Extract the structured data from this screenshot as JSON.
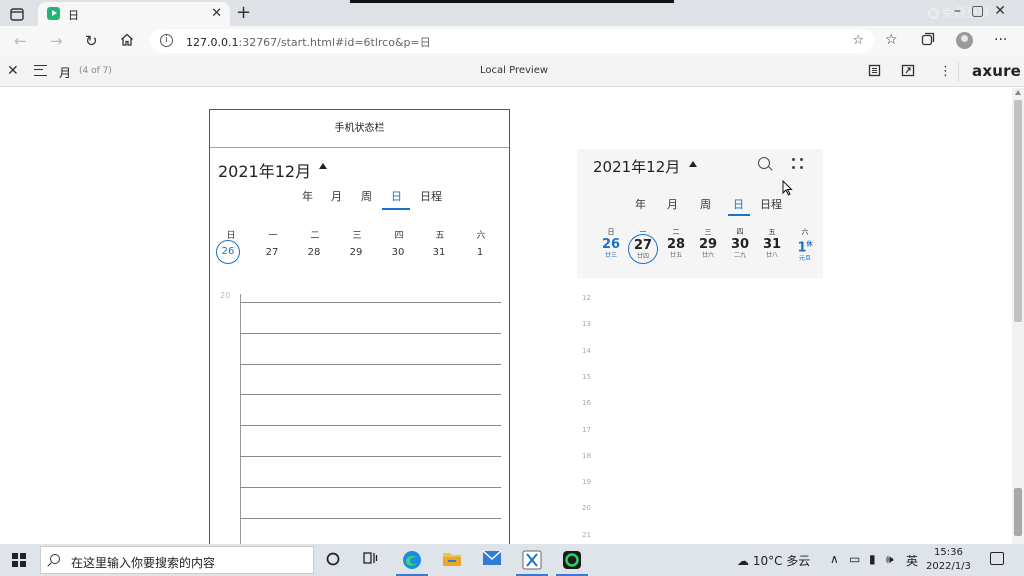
{
  "browser": {
    "tab_title": "日",
    "url_host": "127.0.0.1",
    "url_rest": ":32767/start.html#id=6tlrco&p=日",
    "recorder_label": "免费录屏"
  },
  "axure": {
    "page_name": "月",
    "page_count": "(4 of 7)",
    "center_title": "Local Preview",
    "logo": "axure"
  },
  "phone": {
    "statusbar": "手机状态栏",
    "month_title": "2021年12月",
    "views": [
      "年",
      "月",
      "周",
      "日",
      "日程"
    ],
    "active_view": "日",
    "weekdays": [
      "日",
      "一",
      "二",
      "三",
      "四",
      "五",
      "六"
    ],
    "dates": [
      "26",
      "27",
      "28",
      "29",
      "30",
      "31",
      "1"
    ],
    "selected_date": "26",
    "row_label": "20",
    "grid_lines": 9
  },
  "right_calendar": {
    "month_title": "2021年12月",
    "views": [
      "年",
      "月",
      "周",
      "日",
      "日程"
    ],
    "active_view": "日",
    "weekdays": [
      "日",
      "一",
      "二",
      "三",
      "四",
      "五",
      "六"
    ],
    "days": [
      {
        "num": "26",
        "lunar": "廿三",
        "style": "blue"
      },
      {
        "num": "27",
        "lunar": "廿四",
        "style": "selected"
      },
      {
        "num": "28",
        "lunar": "廿五",
        "style": "normal"
      },
      {
        "num": "29",
        "lunar": "廿六",
        "style": "normal"
      },
      {
        "num": "30",
        "lunar": "二九",
        "style": "normal"
      },
      {
        "num": "31",
        "lunar": "廿八",
        "style": "normal"
      },
      {
        "num": "1",
        "lunar": "元旦",
        "style": "blue",
        "badge": "休"
      }
    ],
    "hours": [
      "12",
      "13",
      "14",
      "15",
      "16",
      "17",
      "18",
      "19",
      "20",
      "21"
    ]
  },
  "taskbar": {
    "search_placeholder": "在这里输入你要搜索的内容",
    "weather": "10°C 多云",
    "ime": "英",
    "time": "15:36",
    "date": "2022/1/3"
  },
  "colors": {
    "accent": "#1a73c8",
    "tab_favicon": "#22b573"
  }
}
